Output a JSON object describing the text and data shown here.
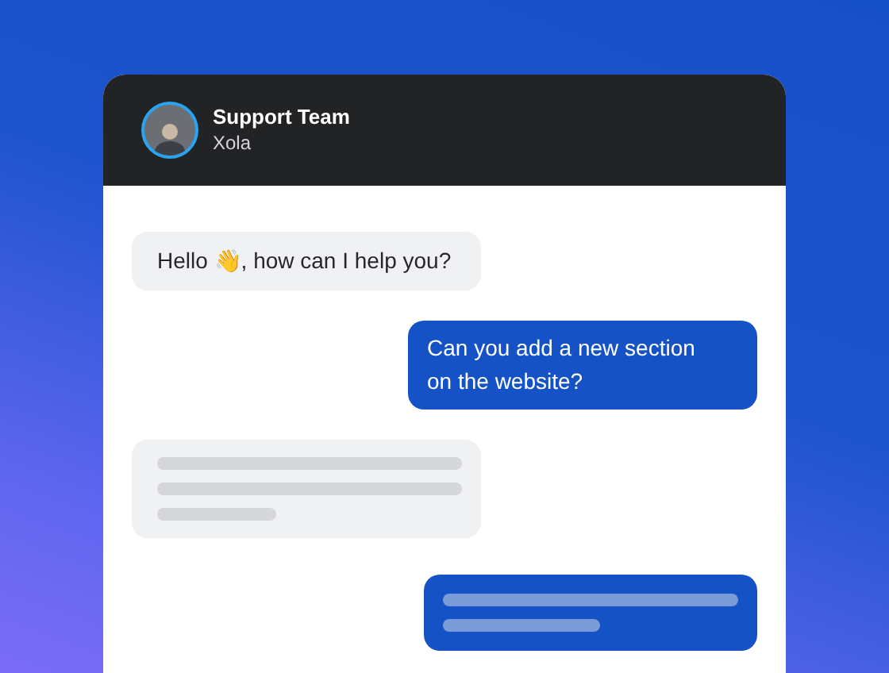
{
  "header": {
    "name": "Support Team",
    "company": "Xola"
  },
  "messages": [
    {
      "kind": "text",
      "outgoing": false,
      "text": "Hello 👋, how can I help you?"
    },
    {
      "kind": "text",
      "outgoing": true,
      "text": "Can you add a new section on the website?"
    },
    {
      "kind": "skeleton",
      "outgoing": false
    },
    {
      "kind": "skeleton",
      "outgoing": true
    }
  ]
}
